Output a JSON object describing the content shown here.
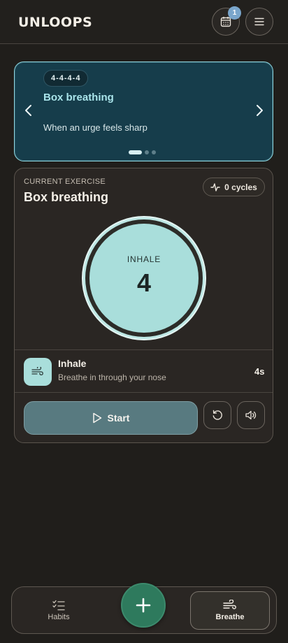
{
  "header": {
    "logo": "UNLOOPS",
    "calendar_badge": "1"
  },
  "carousel": {
    "chip": "4-4-4-4",
    "title": "Box breathing",
    "subtitle": "When an urge feels sharp",
    "slides": 3,
    "active_slide": 1
  },
  "exercise": {
    "label": "CURRENT EXERCISE",
    "title": "Box breathing",
    "cycles": "0 cycles",
    "phase": "INHALE",
    "count": "4",
    "step_title": "Inhale",
    "step_sub": "Breathe in through your nose",
    "step_duration": "4s",
    "start_label": "Start"
  },
  "nav": {
    "habits": "Habits",
    "breathe": "Breathe",
    "active": "breathe"
  },
  "colors": {
    "accent": "#a9dedb",
    "fab": "#2e7a5d",
    "carousel_bg": "#163d4b",
    "badge": "#7aa6cc"
  },
  "icons": [
    "calendar-icon",
    "menu-icon",
    "chevron-left-icon",
    "chevron-right-icon",
    "pulse-icon",
    "wind-icon",
    "play-icon",
    "reset-icon",
    "volume-icon",
    "checklist-icon",
    "plus-icon"
  ]
}
